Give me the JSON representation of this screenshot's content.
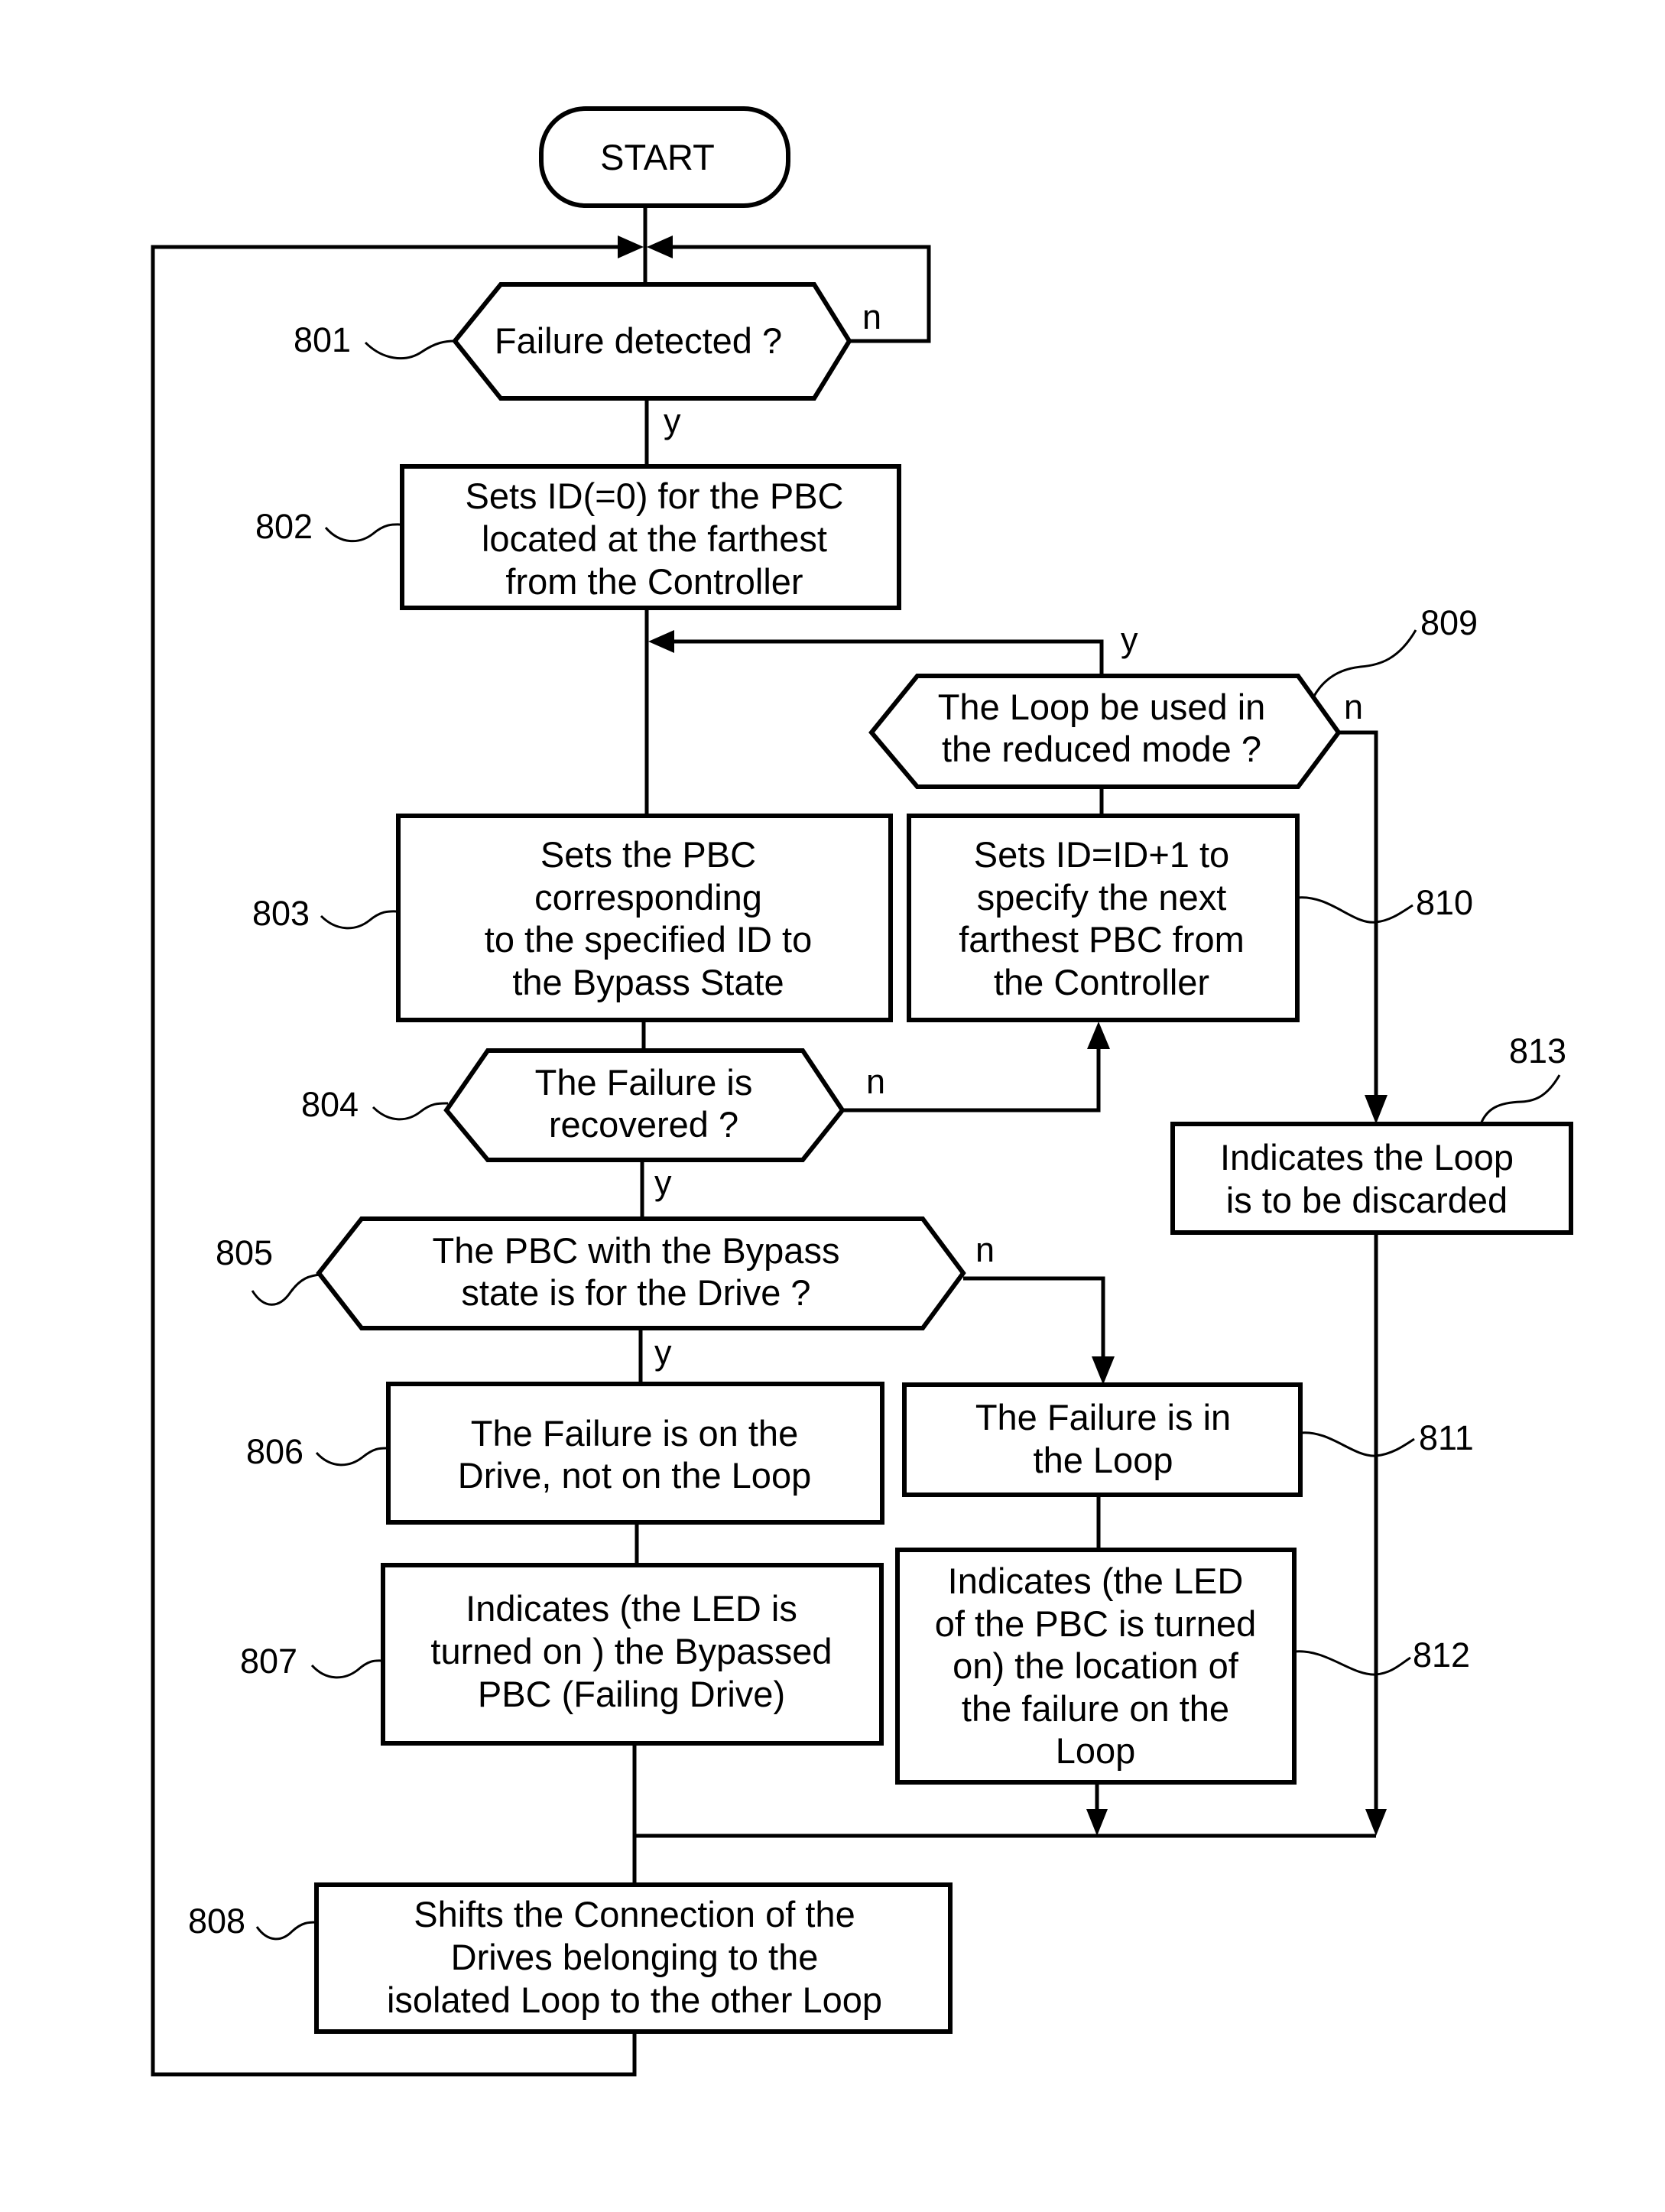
{
  "figure": {
    "type": "flowchart",
    "nodes": [
      {
        "id": "start",
        "shape": "terminal",
        "lines": [
          "START"
        ]
      },
      {
        "id": "801",
        "shape": "decision",
        "ref": "801",
        "lines": [
          "Failure detected ?"
        ]
      },
      {
        "id": "802",
        "shape": "process",
        "ref": "802",
        "lines": [
          "Sets ID(=0) for the PBC",
          "located at the farthest",
          "from the Controller"
        ]
      },
      {
        "id": "803",
        "shape": "process",
        "ref": "803",
        "lines": [
          "Sets the PBC",
          "corresponding",
          "to the specified ID to",
          "the Bypass State"
        ]
      },
      {
        "id": "804",
        "shape": "decision",
        "ref": "804",
        "lines": [
          "The Failure is",
          "recovered ?"
        ]
      },
      {
        "id": "805",
        "shape": "decision",
        "ref": "805",
        "lines": [
          "The PBC with the Bypass",
          "state is for the Drive ?"
        ]
      },
      {
        "id": "806",
        "shape": "process",
        "ref": "806",
        "lines": [
          "The Failure is on the",
          "Drive, not on the Loop"
        ]
      },
      {
        "id": "807",
        "shape": "process",
        "ref": "807",
        "lines": [
          "Indicates (the LED is",
          "turned on ) the Bypassed",
          "PBC (Failing Drive)"
        ]
      },
      {
        "id": "808",
        "shape": "process",
        "ref": "808",
        "lines": [
          "Shifts the Connection of the",
          "Drives belonging to the",
          "isolated Loop to the other Loop"
        ]
      },
      {
        "id": "809",
        "shape": "decision",
        "ref": "809",
        "lines": [
          "The Loop be used in",
          "the reduced mode ?"
        ]
      },
      {
        "id": "810",
        "shape": "process",
        "ref": "810",
        "lines": [
          "Sets ID=ID+1 to",
          "specify the next",
          "farthest PBC from",
          "the Controller"
        ]
      },
      {
        "id": "811",
        "shape": "process",
        "ref": "811",
        "lines": [
          "The Failure is in",
          "the Loop"
        ]
      },
      {
        "id": "812",
        "shape": "process",
        "ref": "812",
        "lines": [
          "Indicates (the LED",
          "of the PBC is turned",
          "on) the location of",
          "the failure on the",
          "Loop"
        ]
      },
      {
        "id": "813",
        "shape": "process",
        "ref": "813",
        "lines": [
          "Indicates the Loop",
          "is to be discarded"
        ]
      }
    ],
    "edges": [
      {
        "from": "start",
        "to": "801",
        "label": ""
      },
      {
        "from": "801",
        "to": "801",
        "label": "n"
      },
      {
        "from": "801",
        "to": "802",
        "label": "y"
      },
      {
        "from": "802",
        "to": "803",
        "label": ""
      },
      {
        "from": "803",
        "to": "804",
        "label": ""
      },
      {
        "from": "804",
        "to": "810",
        "label": "n"
      },
      {
        "from": "810",
        "to": "809",
        "label": ""
      },
      {
        "from": "809",
        "to": "803",
        "label": "y"
      },
      {
        "from": "809",
        "to": "813",
        "label": "n"
      },
      {
        "from": "804",
        "to": "805",
        "label": "y"
      },
      {
        "from": "805",
        "to": "806",
        "label": "y"
      },
      {
        "from": "805",
        "to": "811",
        "label": "n"
      },
      {
        "from": "806",
        "to": "807",
        "label": ""
      },
      {
        "from": "811",
        "to": "812",
        "label": ""
      },
      {
        "from": "807",
        "to": "808",
        "label": ""
      },
      {
        "from": "812",
        "to": "808",
        "label": ""
      },
      {
        "from": "813",
        "to": "808",
        "label": ""
      },
      {
        "from": "808",
        "to": "801",
        "label": ""
      }
    ],
    "branch_labels": {
      "yes": "y",
      "no": "n"
    }
  }
}
